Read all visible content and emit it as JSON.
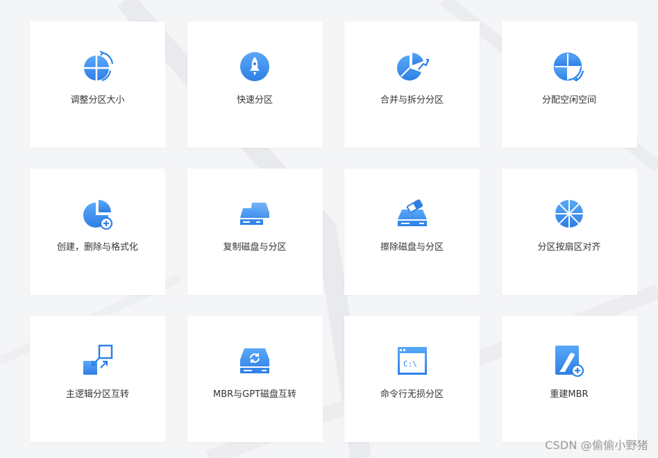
{
  "colors": {
    "accent": "#4a9af5",
    "accent_dark": "#2e7fe6",
    "background": "#f4f5f7",
    "card": "#ffffff"
  },
  "features": [
    {
      "label": "调整分区大小",
      "icon": "resize-partition-icon"
    },
    {
      "label": "快速分区",
      "icon": "rocket-icon"
    },
    {
      "label": "合并与拆分分区",
      "icon": "merge-split-pie-icon"
    },
    {
      "label": "分配空闲空间",
      "icon": "allocate-space-icon"
    },
    {
      "label": "创建，删除与格式化",
      "icon": "create-partition-icon"
    },
    {
      "label": "复制磁盘与分区",
      "icon": "copy-disk-icon"
    },
    {
      "label": "擦除磁盘与分区",
      "icon": "wipe-disk-icon"
    },
    {
      "label": "分区按扇区对齐",
      "icon": "sector-align-icon"
    },
    {
      "label": "主逻辑分区互转",
      "icon": "convert-primary-logical-icon"
    },
    {
      "label": "MBR与GPT磁盘互转",
      "icon": "mbr-gpt-convert-icon"
    },
    {
      "label": "命令行无损分区",
      "icon": "command-line-icon"
    },
    {
      "label": "重建MBR",
      "icon": "rebuild-mbr-icon"
    }
  ],
  "watermark": "CSDN @偷偷小野猪"
}
